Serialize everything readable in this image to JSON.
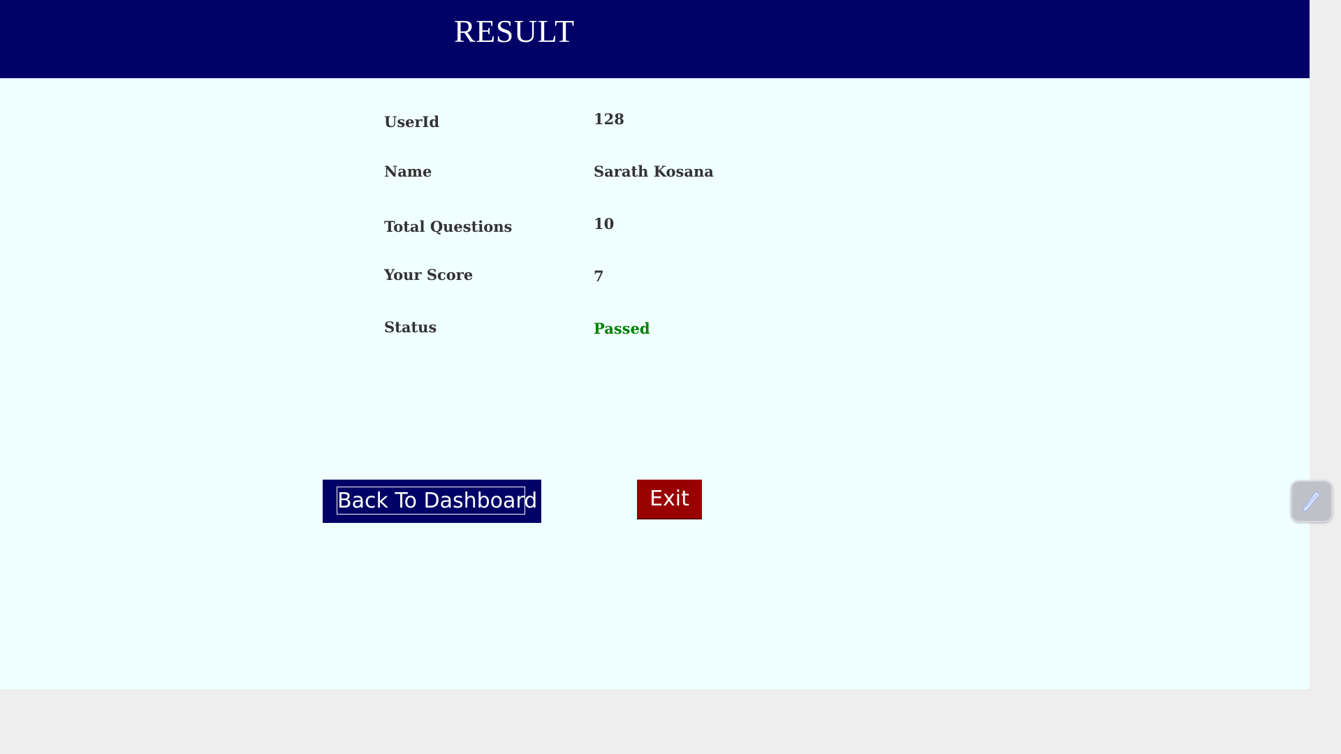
{
  "header": {
    "title": "RESULT",
    "color": "#000066"
  },
  "result": {
    "rows": [
      {
        "label": "UserId",
        "value": "128"
      },
      {
        "label": "Name",
        "value": "Sarath Kosana"
      },
      {
        "label": "Total Questions",
        "value": "10"
      },
      {
        "label": "Your Score",
        "value": "7"
      },
      {
        "label": "Status",
        "value": "Passed"
      }
    ],
    "status_color": "#008000"
  },
  "buttons": {
    "back_label": "Back To Dashboard",
    "back_color": "#000066",
    "exit_label": "Exit",
    "exit_color": "#990000"
  },
  "floating_widget": {
    "icon": "pen-icon"
  }
}
